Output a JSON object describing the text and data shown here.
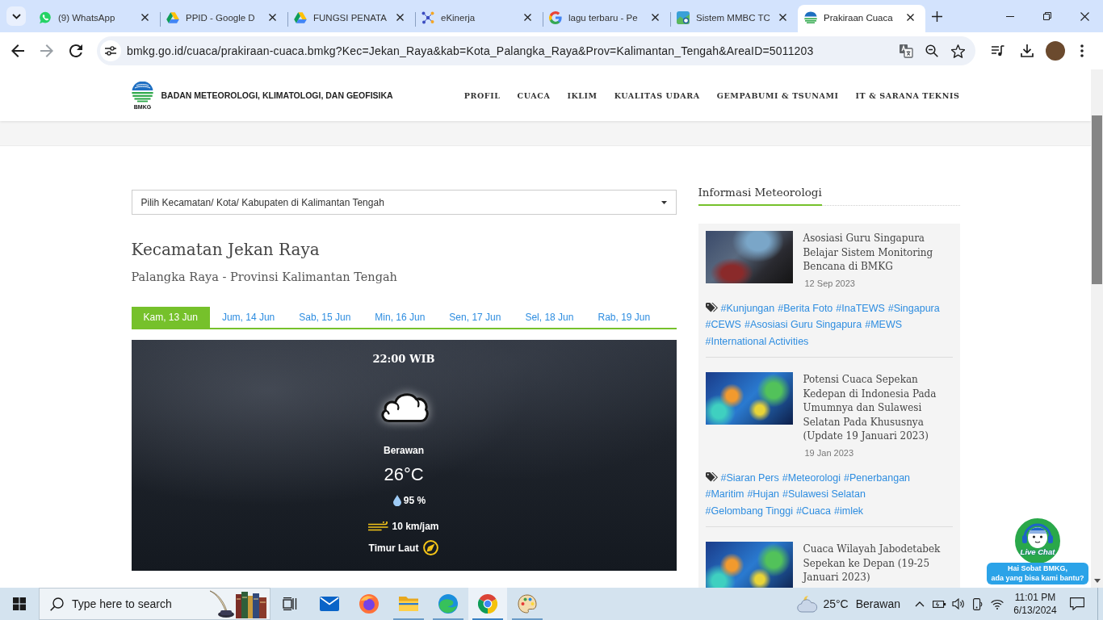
{
  "browser": {
    "tabs": [
      {
        "title": "(9) WhatsApp",
        "selected": false
      },
      {
        "title": "PPID - Google D",
        "selected": false
      },
      {
        "title": "FUNGSI PENATA",
        "selected": false
      },
      {
        "title": "eKinerja",
        "selected": false
      },
      {
        "title": "lagu terbaru - Pe",
        "selected": false
      },
      {
        "title": "Sistem MMBC TC",
        "selected": false
      },
      {
        "title": "Prakiraan Cuaca",
        "selected": true
      }
    ],
    "back_disabled": false,
    "forward_disabled": true,
    "url": "bmkg.go.id/cuaca/prakiraan-cuaca.bmkg?Kec=Jekan_Raya&kab=Kota_Palangka_Raya&Prov=Kalimantan_Tengah&AreaID=5011203"
  },
  "site_header": {
    "logo_text": "BMKG",
    "org_name": "BADAN METEOROLOGI, KLIMATOLOGI, DAN GEOFISIKA",
    "nav": [
      "PROFIL",
      "CUACA",
      "IKLIM",
      "KUALITAS UDARA",
      "GEMPABUMI & TSUNAMI",
      "IT & SARANA TEKNIS"
    ]
  },
  "location_select": {
    "value": "Pilih Kecamatan/ Kota/ Kabupaten di Kalimantan Tengah"
  },
  "heading": "Kecamatan Jekan Raya",
  "subheading": "Palangka Raya - Provinsi Kalimantan Tengah",
  "day_tabs": [
    {
      "label": "Kam, 13 Jun",
      "selected": true
    },
    {
      "label": "Jum, 14 Jun",
      "selected": false
    },
    {
      "label": "Sab, 15 Jun",
      "selected": false
    },
    {
      "label": "Min, 16 Jun",
      "selected": false
    },
    {
      "label": "Sen, 17 Jun",
      "selected": false
    },
    {
      "label": "Sel, 18 Jun",
      "selected": false
    },
    {
      "label": "Rab, 19 Jun",
      "selected": false
    }
  ],
  "forecast": {
    "time": "22:00 WIB",
    "condition": "Berawan",
    "temperature": "26°C",
    "humidity": "95 %",
    "wind_speed": "10 km/jam",
    "wind_direction": "Timur Laut"
  },
  "sidebar": {
    "title": "Informasi Meteorologi",
    "articles": [
      {
        "title": "Asosiasi Guru Singapura Belajar Sistem Monitoring Bencana di BMKG",
        "date": "12 Sep 2023",
        "tags": [
          "#Kunjungan",
          "#Berita Foto",
          "#InaTEWS",
          "#Singapura",
          "#CEWS",
          "#Asosiasi Guru Singapura",
          "#MEWS",
          "#International Activities"
        ]
      },
      {
        "title": "Potensi Cuaca Sepekan Kedepan di Indonesia Pada Umumnya dan Sulawesi Selatan Pada Khususnya (Update 19 Januari 2023)",
        "date": "19 Jan 2023",
        "tags": [
          "#Siaran Pers",
          "#Meteorologi",
          "#Penerbangan",
          "#Maritim",
          "#Hujan",
          "#Sulawesi Selatan",
          "#Gelombang Tinggi",
          "#Cuaca",
          "#imlek"
        ]
      },
      {
        "title": "Cuaca Wilayah Jabodetabek Sepekan ke Depan (19-25 Januari 2023)"
      }
    ]
  },
  "live_chat": {
    "label": "Live Chat",
    "message": "Hai Sobat BMKG,\nada yang bisa kami bantu?"
  },
  "taskbar": {
    "search": {
      "placeholder": "Type here to search"
    },
    "apps": [
      {
        "running": false,
        "selected": false
      },
      {
        "running": false,
        "selected": false
      },
      {
        "running": true,
        "selected": false
      },
      {
        "running": true,
        "selected": false
      },
      {
        "running": true,
        "selected": true
      },
      {
        "running": true,
        "selected": false
      }
    ],
    "weather": {
      "temperature": "25°C",
      "condition": "Berawan"
    },
    "clock": {
      "time": "11:01 PM",
      "date": "6/13/2024"
    }
  }
}
